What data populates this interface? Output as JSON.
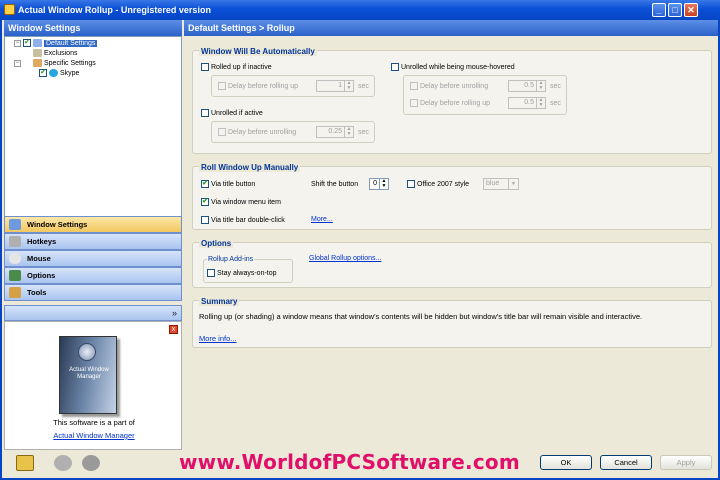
{
  "window": {
    "title": "Actual Window Rollup - Unregistered version",
    "controls": {
      "minimize": "_",
      "maximize": "□",
      "close": "✕"
    }
  },
  "left": {
    "header": "Window Settings",
    "tree": [
      {
        "label": "Default Settings",
        "checked": true,
        "selected": true
      },
      {
        "label": "Exclusions",
        "checked": false
      },
      {
        "label": "Specific Settings",
        "checked": false
      },
      {
        "label": "Skype",
        "checked": true
      }
    ],
    "nav": [
      {
        "label": "Window Settings",
        "icon": "window-icon",
        "active": true
      },
      {
        "label": "Hotkeys",
        "icon": "keyboard-icon"
      },
      {
        "label": "Mouse",
        "icon": "mouse-icon"
      },
      {
        "label": "Options",
        "icon": "options-icon"
      },
      {
        "label": "Tools",
        "icon": "tools-icon"
      }
    ],
    "nav_more": "»",
    "promo": {
      "close": "x",
      "box_text": "Actual Window Manager",
      "text": "This software is a part of",
      "link": "Actual Window Manager"
    }
  },
  "right": {
    "header": "Default Settings > Rollup",
    "auto": {
      "title": "Window Will Be Automatically",
      "rolled_up_inactive": "Rolled up if inactive",
      "delay_rolling_up": "Delay before rolling up",
      "delay_rolling_up_value": "1",
      "unrolled_active": "Unrolled if active",
      "delay_unrolling": "Delay before unrolling",
      "delay_unrolling_value": "0.25",
      "unrolled_hovered": "Unrolled while being mouse-hovered",
      "hover_delay_unrolling": "Delay before unrolling",
      "hover_delay_unrolling_value": "0.5",
      "hover_delay_rolling_up": "Delay before rolling up",
      "hover_delay_rolling_up_value": "0.5",
      "sec": "sec"
    },
    "manual": {
      "title": "Roll Window Up Manually",
      "via_title_button": "Via title button",
      "shift_button": "Shift the button",
      "shift_value": "0",
      "office_style": "Office 2007 style",
      "style_value": "blue",
      "via_menu_item": "Via window menu item",
      "via_double_click": "Via title bar double-click",
      "more": "More..."
    },
    "options": {
      "title": "Options",
      "addins_title": "Rollup Add-ins",
      "stay_on_top": "Stay always-on-top",
      "global_link": "Global Rollup options..."
    },
    "summary": {
      "title": "Summary",
      "text": "Rolling up (or shading) a window means that window's contents will be hidden but window's title bar will remain visible and interactive.",
      "more_info": "More info..."
    }
  },
  "footer": {
    "watermark": "www.WorldofPCSoftware.com",
    "ok": "OK",
    "cancel": "Cancel",
    "apply": "Apply"
  }
}
